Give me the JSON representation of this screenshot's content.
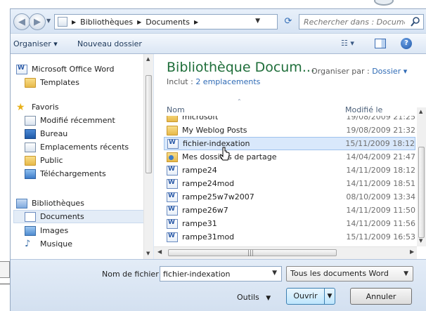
{
  "address_bar": {
    "breadcrumbs": [
      "Bibliothèques",
      "Documents"
    ],
    "search_placeholder": "Rechercher dans : Documents"
  },
  "toolbar": {
    "organiser": "Organiser ▾",
    "new_folder": "Nouveau dossier"
  },
  "nav_pane": {
    "top_items": [
      {
        "label": "Microsoft Office Word",
        "icon": "word-icon"
      },
      {
        "label": "Templates",
        "icon": "folder-icon"
      }
    ],
    "favorites_header": "Favoris",
    "favorites": [
      {
        "label": "Modifié récemment",
        "icon": "recent-icon"
      },
      {
        "label": "Bureau",
        "icon": "desktop-icon"
      },
      {
        "label": "Emplacements récents",
        "icon": "recent-places-icon"
      },
      {
        "label": "Public",
        "icon": "folder-icon"
      },
      {
        "label": "Téléchargements",
        "icon": "downloads-icon"
      }
    ],
    "libraries_header": "Bibliothèques",
    "libraries": [
      {
        "label": "Documents",
        "icon": "documents-library-icon",
        "selected": true
      },
      {
        "label": "Images",
        "icon": "images-library-icon"
      },
      {
        "label": "Musique",
        "icon": "music-library-icon"
      }
    ]
  },
  "main": {
    "library_title": "Bibliothèque Docum...",
    "includes_label": "Inclut : ",
    "includes_link": "2 emplacements",
    "arrange_label": "Organiser par : ",
    "arrange_value": "Dossier ▾",
    "columns": {
      "name": "Nom",
      "modified": "Modifié le"
    },
    "files": [
      {
        "name": "microsoft",
        "date": "19/08/2009 21:25",
        "icon": "folder-icon"
      },
      {
        "name": "My Weblog Posts",
        "date": "19/08/2009 21:32",
        "icon": "folder-icon"
      },
      {
        "name": "fichier-indexation",
        "date": "15/11/2009 18:12",
        "icon": "word-doc-icon",
        "selected": true
      },
      {
        "name": "Mes dossiers de partage",
        "date": "14/04/2009 21:47",
        "icon": "shared-folder-icon"
      },
      {
        "name": "rampe24",
        "date": "14/11/2009 18:12",
        "icon": "word-doc-icon"
      },
      {
        "name": "rampe24mod",
        "date": "14/11/2009 18:51",
        "icon": "word-doc-icon"
      },
      {
        "name": "rampe25w7w2007",
        "date": "08/10/2009 13:34",
        "icon": "word-doc-icon"
      },
      {
        "name": "rampe26w7",
        "date": "14/11/2009 11:50",
        "icon": "word-doc-icon"
      },
      {
        "name": "rampe31",
        "date": "14/11/2009 11:56",
        "icon": "word-doc-icon"
      },
      {
        "name": "rampe31mod",
        "date": "15/11/2009 16:53",
        "icon": "word-doc-icon"
      }
    ]
  },
  "bottom": {
    "filename_label": "Nom de fichier :",
    "filename_value": "fichier-indexation",
    "filetype_value": "Tous les documents Word",
    "tools_label": "Outils",
    "open_label": "Ouvrir",
    "cancel_label": "Annuler"
  },
  "colors": {
    "title_green": "#1f6e3a",
    "link_blue": "#2e6ab5",
    "selection": "#d9e8fb",
    "chrome": "#dce7f5"
  }
}
